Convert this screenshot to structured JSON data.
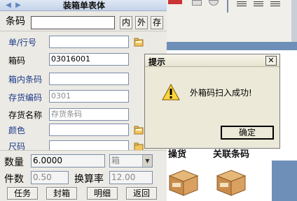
{
  "window": {
    "title": "装箱单表体"
  },
  "barcode": {
    "label": "条码",
    "value": "",
    "btn_in": "内",
    "btn_out": "外",
    "btn_save": "存"
  },
  "form": [
    {
      "label": "单/行号",
      "value": "",
      "placeholder": ""
    },
    {
      "label": "箱码",
      "value": "03016001",
      "placeholder": ""
    },
    {
      "label": "箱内条码",
      "value": "",
      "placeholder": ""
    },
    {
      "label": "存货编码",
      "value": "",
      "placeholder": "0301"
    },
    {
      "label": "存货名称",
      "value": "",
      "placeholder": "存货条码"
    },
    {
      "label": "颜色",
      "value": "",
      "placeholder": ""
    },
    {
      "label": "尺码",
      "value": "",
      "placeholder": ""
    }
  ],
  "qty": {
    "label": "数量",
    "value": "6.0000",
    "unit": "箱"
  },
  "pieces": {
    "label": "件数",
    "value": "0.50",
    "rate_label": "换算率",
    "rate_value": "12.00"
  },
  "bottom_buttons": [
    "任务",
    "封箱",
    "明细",
    "返回"
  ],
  "right": {
    "item1_label": "操货",
    "item2_label": "关联条码"
  },
  "dialog": {
    "title": "提示",
    "message": "外箱码扫入成功!",
    "ok": "确定"
  },
  "colors": {
    "background": "#6e8fb7",
    "panel": "#eceae4",
    "label": "#1b3a8a"
  }
}
